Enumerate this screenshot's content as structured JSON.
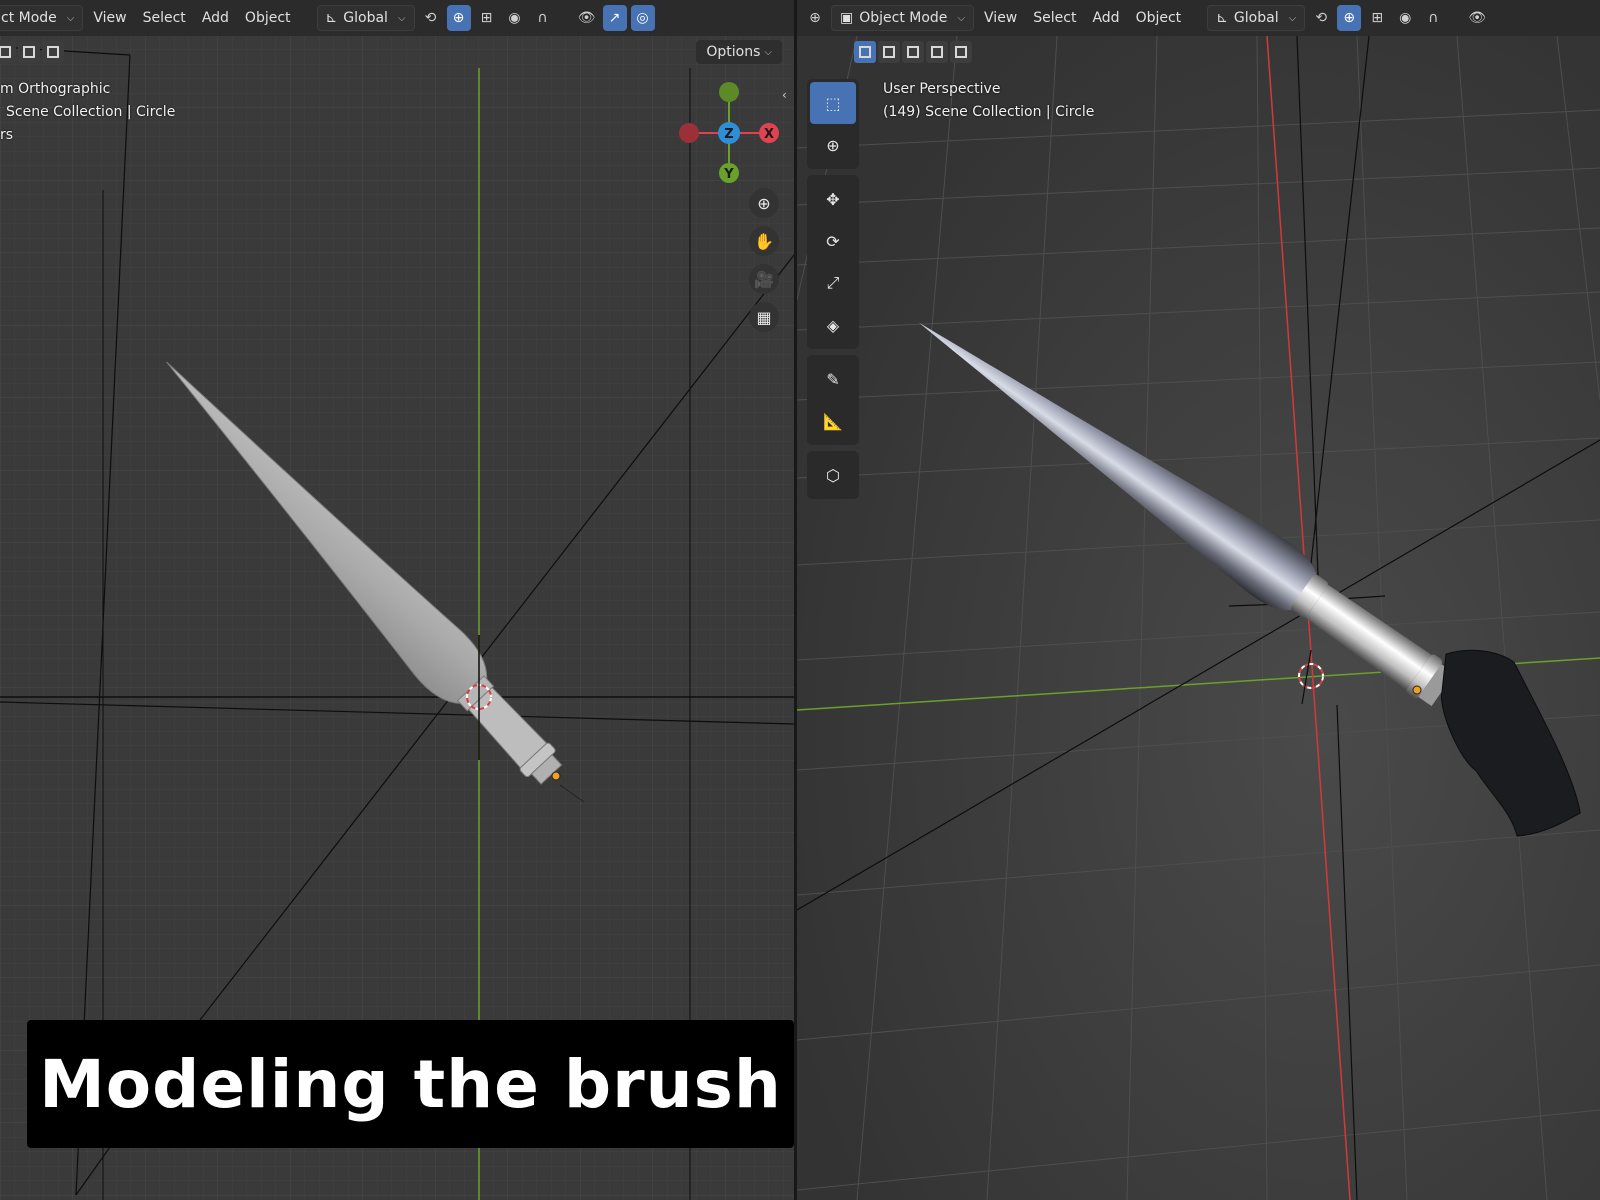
{
  "left": {
    "header": {
      "mode_label": "ct Mode",
      "menu": [
        "View",
        "Select",
        "Add",
        "Object"
      ],
      "orientation_label": "Global"
    },
    "options_label": "Options",
    "info": {
      "line1": "m Orthographic",
      "line2": "Scene Collection | Circle",
      "line3": "rs"
    },
    "gizmo_axes": {
      "x": "X",
      "y": "Y",
      "z": "Z"
    },
    "nav_icons": [
      "zoom-icon",
      "hand-pan-icon",
      "camera-icon",
      "grid-icon"
    ]
  },
  "right": {
    "header": {
      "mode_label": "Object Mode",
      "menu": [
        "View",
        "Select",
        "Add",
        "Object"
      ],
      "orientation_label": "Global"
    },
    "info": {
      "line1": "User Perspective",
      "line2": "(149) Scene Collection | Circle"
    },
    "tools": [
      "select-box-icon",
      "cursor-icon",
      "move-icon",
      "rotate-icon",
      "scale-icon",
      "transform-icon",
      "annotate-icon",
      "measure-icon",
      "add-cube-icon"
    ]
  },
  "caption": "Modeling the brush",
  "colors": {
    "accent": "#4772b3",
    "axis_x": "#e0434f",
    "axis_y": "#6aa12a",
    "axis_z": "#2f8fd6",
    "viewport_bg": "#3a3a3a",
    "header_bg": "#2b2b2b"
  }
}
